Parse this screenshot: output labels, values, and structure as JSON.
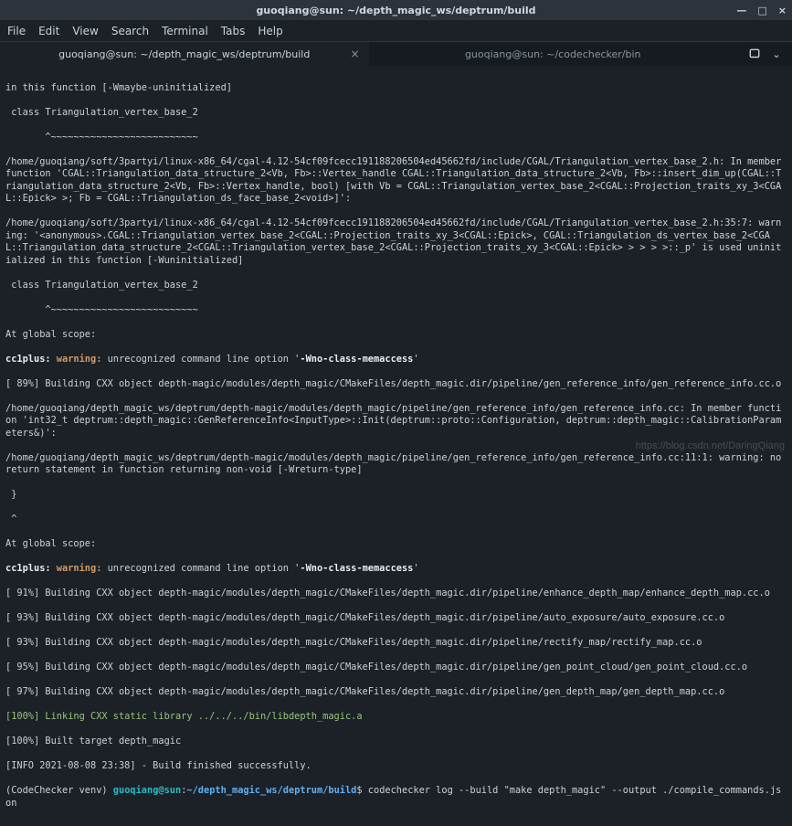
{
  "window": {
    "title": "guoqiang@sun: ~/depth_magic_ws/deptrum/build",
    "controls": {
      "minimize": "—",
      "maximize": "□",
      "close": "×"
    }
  },
  "menu": {
    "items": [
      "File",
      "Edit",
      "View",
      "Search",
      "Terminal",
      "Tabs",
      "Help"
    ]
  },
  "tabs": {
    "list": [
      {
        "label": "guoqiang@sun: ~/depth_magic_ws/deptrum/build",
        "active": true
      },
      {
        "label": "guoqiang@sun: ~/codechecker/bin",
        "active": false
      }
    ],
    "close_glyph": "×",
    "dropdown_glyph": "⌄"
  },
  "term": {
    "l0": "in this function [-Wmaybe-uninitialized]",
    "l1": " class Triangulation_vertex_base_2",
    "l2": "       ^~~~~~~~~~~~~~~~~~~~~~~~~~~",
    "l3": "/home/guoqiang/soft/3partyi/linux-x86_64/cgal-4.12-54cf09fcecc191188206504ed45662fd/include/CGAL/Triangulation_vertex_base_2.h: In member function 'CGAL::Triangulation_data_structure_2<Vb, Fb>::Vertex_handle CGAL::Triangulation_data_structure_2<Vb, Fb>::insert_dim_up(CGAL::Triangulation_data_structure_2<Vb, Fb>::Vertex_handle, bool) [with Vb = CGAL::Triangulation_vertex_base_2<CGAL::Projection_traits_xy_3<CGAL::Epick> >; Fb = CGAL::Triangulation_ds_face_base_2<void>]':",
    "l4": "/home/guoqiang/soft/3partyi/linux-x86_64/cgal-4.12-54cf09fcecc191188206504ed45662fd/include/CGAL/Triangulation_vertex_base_2.h:35:7: warning: '<anonymous>.CGAL::Triangulation_vertex_base_2<CGAL::Projection_traits_xy_3<CGAL::Epick>, CGAL::Triangulation_ds_vertex_base_2<CGAL::Triangulation_data_structure_2<CGAL::Triangulation_vertex_base_2<CGAL::Projection_traits_xy_3<CGAL::Epick> > > > >::_p' is used uninitialized in this function [-Wuninitialized]",
    "l5": " class Triangulation_vertex_base_2",
    "l6": "       ^~~~~~~~~~~~~~~~~~~~~~~~~~~",
    "l7": "At global scope:",
    "l8a": "cc1plus: ",
    "l8b": "warning: ",
    "l8c": "unrecognized command line option '",
    "l8d": "-Wno-class-memaccess",
    "l8e": "'",
    "l9": "[ 89%] Building CXX object depth-magic/modules/depth_magic/CMakeFiles/depth_magic.dir/pipeline/gen_reference_info/gen_reference_info.cc.o",
    "l10": "/home/guoqiang/depth_magic_ws/deptrum/depth-magic/modules/depth_magic/pipeline/gen_reference_info/gen_reference_info.cc: In member function 'int32_t deptrum::depth_magic::GenReferenceInfo<InputType>::Init(deptrum::proto::Configuration, deptrum::depth_magic::CalibrationParameters&)':",
    "l11": "/home/guoqiang/depth_magic_ws/deptrum/depth-magic/modules/depth_magic/pipeline/gen_reference_info/gen_reference_info.cc:11:1: warning: no return statement in function returning non-void [-Wreturn-type]",
    "l12": " }",
    "l13": " ^",
    "l14": "At global scope:",
    "l15a": "cc1plus: ",
    "l15b": "warning: ",
    "l15c": "unrecognized command line option '",
    "l15d": "-Wno-class-memaccess",
    "l15e": "'",
    "l16": "[ 91%] Building CXX object depth-magic/modules/depth_magic/CMakeFiles/depth_magic.dir/pipeline/enhance_depth_map/enhance_depth_map.cc.o",
    "l17": "[ 93%] Building CXX object depth-magic/modules/depth_magic/CMakeFiles/depth_magic.dir/pipeline/auto_exposure/auto_exposure.cc.o",
    "l18": "[ 93%] Building CXX object depth-magic/modules/depth_magic/CMakeFiles/depth_magic.dir/pipeline/rectify_map/rectify_map.cc.o",
    "l19": "[ 95%] Building CXX object depth-magic/modules/depth_magic/CMakeFiles/depth_magic.dir/pipeline/gen_point_cloud/gen_point_cloud.cc.o",
    "l20": "[ 97%] Building CXX object depth-magic/modules/depth_magic/CMakeFiles/depth_magic.dir/pipeline/gen_depth_map/gen_depth_map.cc.o",
    "l21": "[100%] Linking CXX static library ../../../bin/libdepth_magic.a",
    "l22": "[100%] Built target depth_magic",
    "l23": "[INFO 2021-08-08 23:38] - Build finished successfully.",
    "prompt_prefix": "(CodeChecker venv) ",
    "prompt_userhost": "guoqiang@sun",
    "prompt_colon": ":",
    "prompt_path": "~/depth_magic_ws/deptrum/build",
    "prompt_dollar": "$",
    "cmd": " codechecker log --build \"make depth_magic\" --output ./compile_commands.json"
  },
  "watermark": "https://blog.csdn.net/DaringQiang"
}
